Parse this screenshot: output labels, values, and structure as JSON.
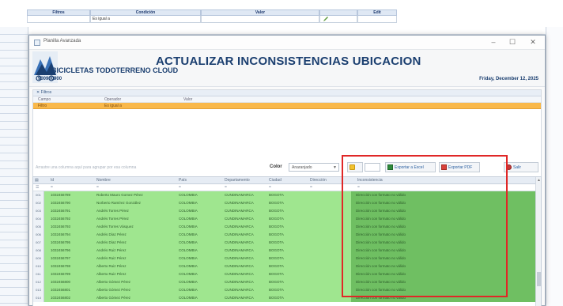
{
  "background": {
    "headers": [
      "Filtros",
      "Condición",
      "Valor",
      "Edit"
    ],
    "row1": [
      "",
      "Es igual a",
      "",
      "",
      ""
    ]
  },
  "window": {
    "title": "Planilla Avanzada",
    "controls": [
      "–",
      "☐",
      "✕"
    ]
  },
  "banner": {
    "title": "ACTUALIZAR INCONSISTENCIAS UBICACION",
    "company": "BICICLETAS TODOTERRENO CLOUD",
    "code": "900900900",
    "date": "Friday, December 12, 2025"
  },
  "filter": {
    "header": "✕ Filtros",
    "columns": [
      "Campo",
      "Operador",
      "Valor"
    ],
    "selected_row": [
      "Filtro",
      "Es igual a",
      ""
    ]
  },
  "toolbar": {
    "group_hint": "Arrastre una columna aquí para agrupar por esa columna",
    "color_label": "Color",
    "color_value": "Anaranjado",
    "export_excel": "Exportar a Excel",
    "export_pdf": "Exportar PDF",
    "exit": "Salir"
  },
  "grid": {
    "columns": [
      "Id",
      "Nombre",
      "País",
      "Departamento",
      "Ciudad",
      "Dirección",
      "Inconsistencia"
    ],
    "filter_row": [
      "☰",
      "=",
      "=",
      "=",
      "=",
      "=",
      "=",
      "="
    ],
    "rows": [
      {
        "n": "001",
        "id": "1032456789",
        "name": "Roberto Mauro Gomez Pérez",
        "country": "COLOMBIA",
        "dept": "CUNDINAMARCA",
        "city": "BOGOTA",
        "dir": "",
        "inc": "Dirección con formato no válido"
      },
      {
        "n": "002",
        "id": "1032456790",
        "name": "Norberto Ramírez González",
        "country": "COLOMBIA",
        "dept": "CUNDINAMARCA",
        "city": "BOGOTA",
        "dir": "",
        "inc": "Dirección con formato no válido"
      },
      {
        "n": "003",
        "id": "1032456791",
        "name": "Andrés Torres Pérez",
        "country": "COLOMBIA",
        "dept": "CUNDINAMARCA",
        "city": "BOGOTA",
        "dir": "",
        "inc": "Dirección con formato no válido"
      },
      {
        "n": "004",
        "id": "1032456792",
        "name": "Andrés Torres Pérez",
        "country": "COLOMBIA",
        "dept": "CUNDINAMARCA",
        "city": "BOGOTA",
        "dir": "",
        "inc": "Dirección con formato no válido"
      },
      {
        "n": "005",
        "id": "1032456793",
        "name": "Andrés Torres Vásquez",
        "country": "COLOMBIA",
        "dept": "CUNDINAMARCA",
        "city": "BOGOTA",
        "dir": "",
        "inc": "Dirección con formato no válido"
      },
      {
        "n": "006",
        "id": "1032456794",
        "name": "Andrés Díaz Pérez",
        "country": "COLOMBIA",
        "dept": "CUNDINAMARCA",
        "city": "BOGOTA",
        "dir": "",
        "inc": "Dirección con formato no válido"
      },
      {
        "n": "007",
        "id": "1032456795",
        "name": "Andrés Díaz Pérez",
        "country": "COLOMBIA",
        "dept": "CUNDINAMARCA",
        "city": "BOGOTA",
        "dir": "",
        "inc": "Dirección con formato no válido"
      },
      {
        "n": "008",
        "id": "1032456796",
        "name": "Andrés Ruiz Pérez",
        "country": "COLOMBIA",
        "dept": "CUNDINAMARCA",
        "city": "BOGOTA",
        "dir": "",
        "inc": "Dirección con formato no válido"
      },
      {
        "n": "009",
        "id": "1032456797",
        "name": "Andrés Ruiz Pérez",
        "country": "COLOMBIA",
        "dept": "CUNDINAMARCA",
        "city": "BOGOTA",
        "dir": "",
        "inc": "Dirección con formato no válido"
      },
      {
        "n": "010",
        "id": "1032456798",
        "name": "Alberto Ruiz Pérez",
        "country": "COLOMBIA",
        "dept": "CUNDINAMARCA",
        "city": "BOGOTA",
        "dir": "",
        "inc": "Dirección con formato no válido"
      },
      {
        "n": "011",
        "id": "1032456799",
        "name": "Alberto Ruiz Pérez",
        "country": "COLOMBIA",
        "dept": "CUNDINAMARCA",
        "city": "BOGOTA",
        "dir": "",
        "inc": "Dirección con formato no válido"
      },
      {
        "n": "012",
        "id": "1032456800",
        "name": "Alberto Gómez Pérez",
        "country": "COLOMBIA",
        "dept": "CUNDINAMARCA",
        "city": "BOGOTA",
        "dir": "",
        "inc": "Dirección con formato no válido"
      },
      {
        "n": "013",
        "id": "1032456801",
        "name": "Alberto Gómez Pérez",
        "country": "COLOMBIA",
        "dept": "CUNDINAMARCA",
        "city": "BOGOTA",
        "dir": "",
        "inc": "Dirección con formato no válido"
      },
      {
        "n": "014",
        "id": "1032456802",
        "name": "Alberto Gómez Pérez",
        "country": "COLOMBIA",
        "dept": "CUNDINAMARCA",
        "city": "BOGOTA",
        "dir": "",
        "inc": "Dirección con formato no válido"
      }
    ]
  },
  "colors": {
    "banner_title": "#1b3f70",
    "selected_filter_row": "#f9b84a",
    "grid_row": "#9fe68f",
    "inconsistency_cell": "#6fbf62",
    "highlight_box": "#e02727"
  }
}
